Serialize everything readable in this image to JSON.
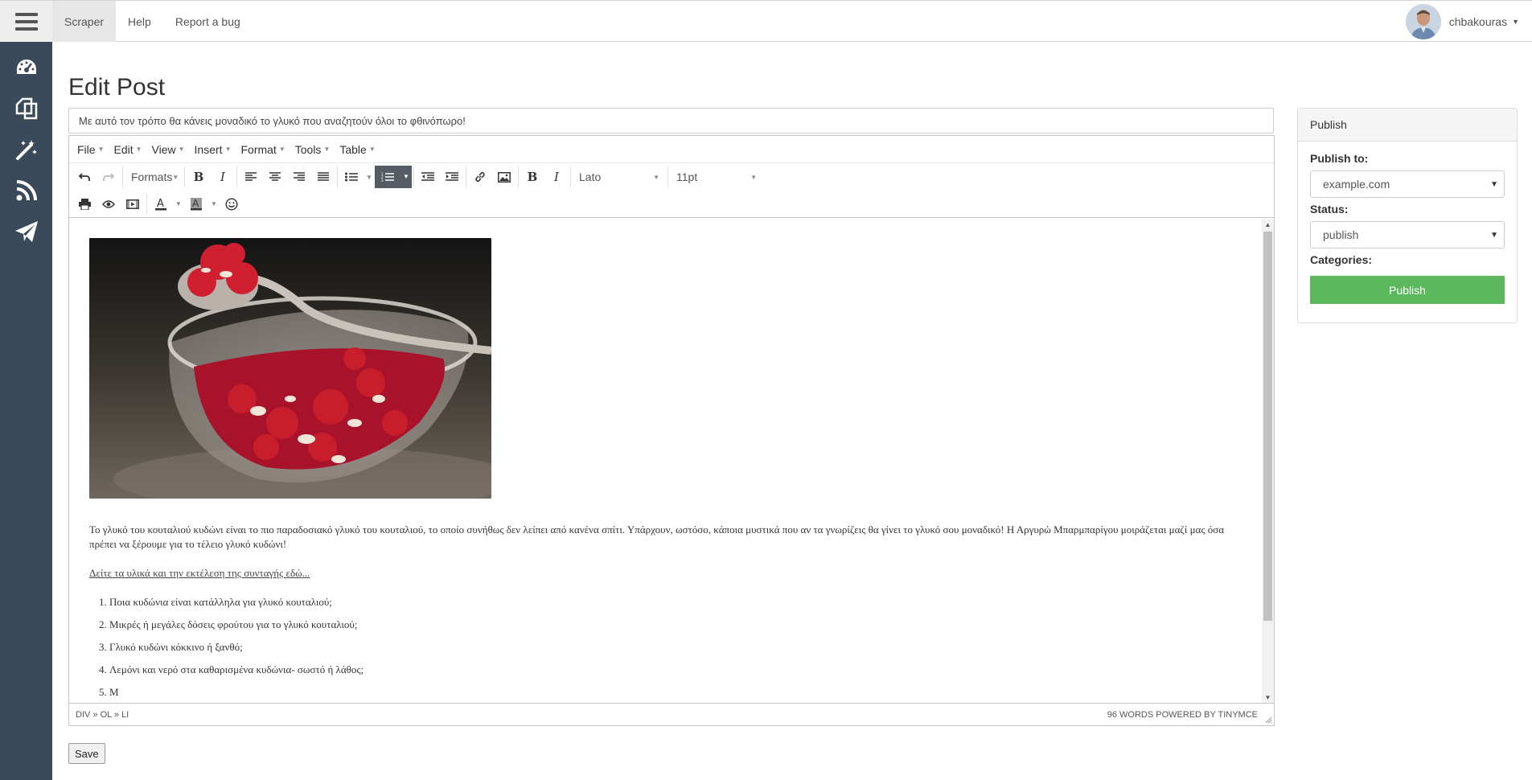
{
  "nav": {
    "links": [
      "Scraper",
      "Help",
      "Report a bug"
    ],
    "user": "chbakouras"
  },
  "sidebar": {
    "icons": [
      "dashboard-icon",
      "copy-icon",
      "magic-wand-icon",
      "rss-icon",
      "paper-plane-icon"
    ]
  },
  "page": {
    "title": "Edit Post",
    "post_title": "Με αυτό τον τρόπο θα κάνεις μοναδικό το γλυκό που αναζητούν όλοι το φθινόπωρο!"
  },
  "editor": {
    "menu": [
      "File",
      "Edit",
      "View",
      "Insert",
      "Format",
      "Tools",
      "Table"
    ],
    "formats_label": "Formats",
    "font_family": "Lato",
    "font_size": "11pt",
    "paragraph": "Το γλυκό του κουταλιού κυδώνι είναι το πιο παραδοσιακό γλυκό του κουταλιού, το οποίο συνήθως δεν λείπει από κανένα σπίτι. Υπάρχουν, ωστόσο, κάποια μυστικά που αν τα γνωρίζεις θα γίνει το γλυκό σου μοναδικό! Η Αργυρώ Μπαρμπαρίγου μοιράζεται μαζί μας όσα πρέπει να ξέρουμε για το τέλειο γλυκό κυδώνι!",
    "link_text": "Δείτε τα υλικά και την εκτέλεση της συνταγής εδώ...",
    "list": [
      "Ποια κυδώνια είναι κατάλληλα για γλυκό κουταλιού;",
      "Μικρές ή μεγάλες δόσεις φρούτου για το γλυκό κουταλιού;",
      "Γλυκό κυδώνι κόκκινο ή ξανθό;",
      "Λεμόνι και νερό στα καθαρισμένα κυδώνια- σωστό ή λάθος;",
      "Μ"
    ],
    "path": "DIV » OL » LI",
    "word_count": "96 WORDS POWERED BY TINYMCE"
  },
  "save_label": "Save",
  "publish": {
    "header": "Publish",
    "publish_to_label": "Publish to:",
    "publish_to_value": "example.com",
    "status_label": "Status:",
    "status_value": "publish",
    "categories_label": "Categories:",
    "button": "Publish"
  },
  "colors": {
    "sidebar": "#3b4a5a",
    "publish_button": "#5cb85c",
    "active_toolbar": "#555c63"
  }
}
